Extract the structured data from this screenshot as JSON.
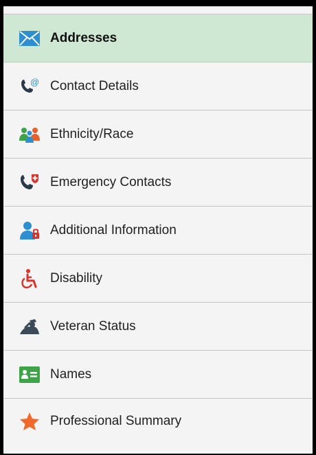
{
  "nav": {
    "items": [
      {
        "label": "Addresses",
        "icon": "envelope-icon",
        "active": true
      },
      {
        "label": "Contact Details",
        "icon": "phone-at-icon",
        "active": false
      },
      {
        "label": "Ethnicity/Race",
        "icon": "people-icon",
        "active": false
      },
      {
        "label": "Emergency Contacts",
        "icon": "emergency-phone-icon",
        "active": false
      },
      {
        "label": "Additional Information",
        "icon": "person-lock-icon",
        "active": false
      },
      {
        "label": "Disability",
        "icon": "wheelchair-icon",
        "active": false
      },
      {
        "label": "Veteran Status",
        "icon": "veteran-icon",
        "active": false
      },
      {
        "label": "Names",
        "icon": "id-card-icon",
        "active": false
      },
      {
        "label": "Professional Summary",
        "icon": "star-icon",
        "active": false
      }
    ]
  },
  "colors": {
    "active_bg": "#cfe8d4",
    "envelope": "#2d8fd0",
    "phone": "#2b3a4a",
    "people_green": "#3fa348",
    "people_orange": "#e8602c",
    "people_blue": "#2d8fd0",
    "emergency_red": "#d9332b",
    "person_blue": "#2d8fd0",
    "wheelchair": "#d9332b",
    "veteran": "#3c4a58",
    "id_card": "#3fa348",
    "star": "#f06a2a"
  }
}
